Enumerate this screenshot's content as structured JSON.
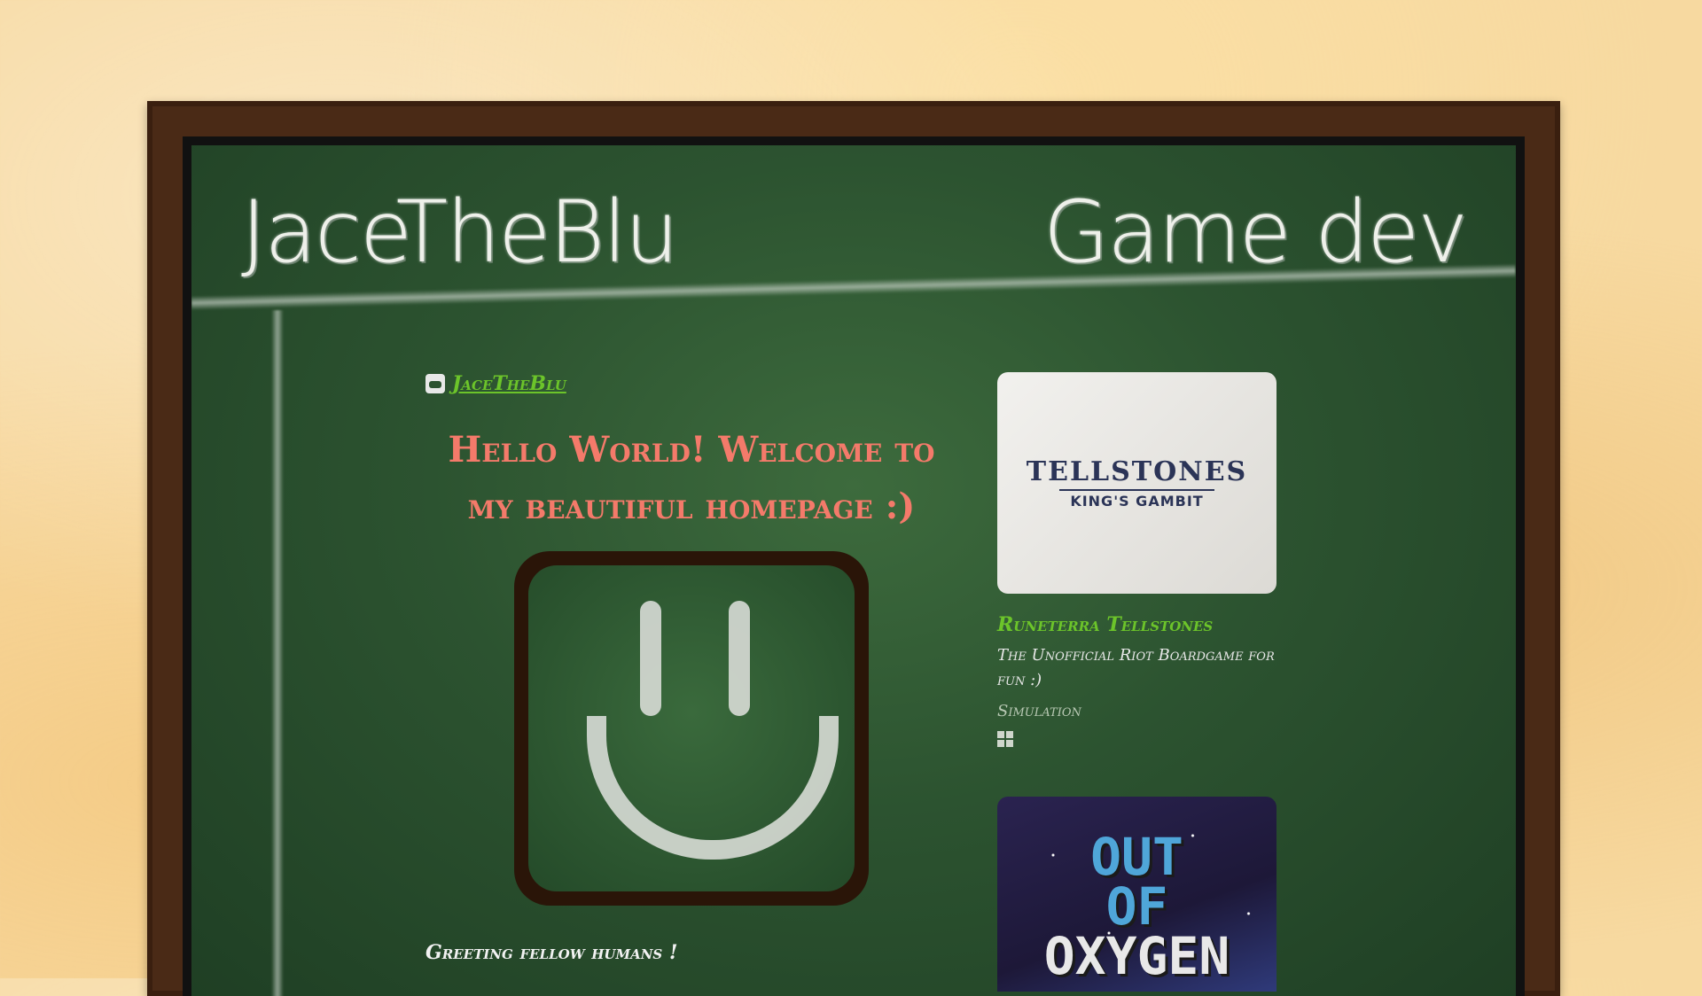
{
  "header": {
    "brand_left": "JaceTheBlu",
    "brand_right": "Game dev"
  },
  "profile": {
    "username": "JaceTheBlu",
    "platform_icon": "itchio-icon"
  },
  "main": {
    "headline_line1": "Hello World! Welcome to",
    "headline_line2": "my beautiful homepage :)",
    "greeting": "Greeting fellow humans !"
  },
  "games": [
    {
      "cover_title": "TELLSTONES",
      "cover_subtitle": "KING'S GAMBIT",
      "title": "Runeterra Tellstones",
      "description": "The Unofficial Riot Boardgame for fun :)",
      "genre": "Simulation",
      "platform_icon": "windows-icon"
    },
    {
      "cover_line1": "OUT",
      "cover_line2": "OF",
      "cover_line3": "OXYGEN"
    }
  ]
}
